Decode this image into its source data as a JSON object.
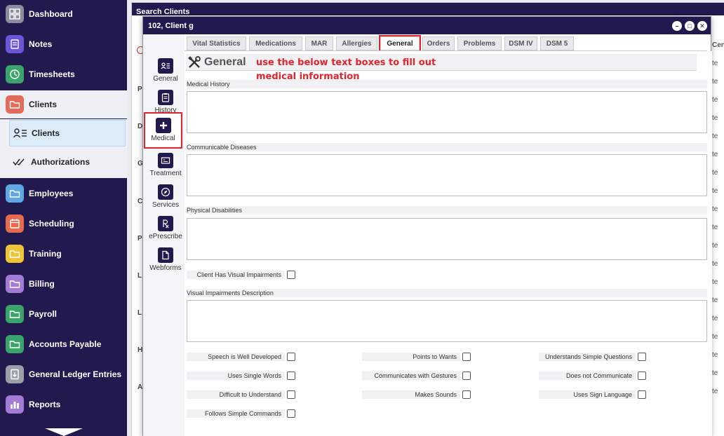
{
  "nav": {
    "items": [
      {
        "label": "Dashboard",
        "color": "#8a8d9c"
      },
      {
        "label": "Notes",
        "color": "#6b56d8"
      },
      {
        "label": "Timesheets",
        "color": "#3aa46a"
      },
      {
        "label": "Clients",
        "color": "#e26b5a"
      },
      {
        "label": "Employees",
        "color": "#5ea8e6"
      },
      {
        "label": "Scheduling",
        "color": "#e56a4f"
      },
      {
        "label": "Training",
        "color": "#f0c437"
      },
      {
        "label": "Billing",
        "color": "#a27bd6"
      },
      {
        "label": "Payroll",
        "color": "#3aa46a"
      },
      {
        "label": "Accounts Payable",
        "color": "#3aa46a"
      },
      {
        "label": "General Ledger Entries",
        "color": "#9aa0aa"
      },
      {
        "label": "Reports",
        "color": "#a27bd6"
      }
    ],
    "sub": {
      "clients": "Clients",
      "authorizations": "Authorizations"
    }
  },
  "search_window": {
    "title": "Search Clients",
    "letters": [
      "P",
      "D",
      "G",
      "C",
      "P",
      "L",
      "L",
      "H",
      "A"
    ],
    "right_header": "Cent",
    "row_text": "te"
  },
  "modal": {
    "title": "102, Client g",
    "controls": {
      "minimize": "–",
      "maximize": "□",
      "close": "✕"
    },
    "side_tabs": [
      {
        "label": "General",
        "icon": "id-card-icon"
      },
      {
        "label": "History",
        "icon": "clipboard-icon"
      },
      {
        "label": "Medical",
        "icon": "plus-icon"
      },
      {
        "label": "Treatment",
        "icon": "chart-icon"
      },
      {
        "label": "Services",
        "icon": "compass-icon"
      },
      {
        "label": "ePrescribe",
        "icon": "rx-icon"
      },
      {
        "label": "Webforms",
        "icon": "document-icon"
      }
    ],
    "top_tabs": [
      "Vital Statistics",
      "Medications",
      "MAR",
      "Allergies",
      "General",
      "Orders",
      "Problems",
      "DSM IV",
      "DSM 5"
    ],
    "active_tab": "General",
    "section_title": "General",
    "annotation_line1": "use the below text boxes to fill out",
    "annotation_line2": "medical information",
    "fields": {
      "medical_history": "Medical History",
      "communicable_diseases": "Communicable Diseases",
      "physical_disabilities": "Physical Disabilities",
      "visual_impairment_check": "Client Has Visual Impairments",
      "visual_impairments_desc": "Visual Impairments Description"
    },
    "checkboxes": {
      "col1": [
        "Speech is Well Developed",
        "Uses Single Words",
        "Difficult to Understand",
        "Follows Simple Commands"
      ],
      "col2": [
        "Points to Wants",
        "Communicates with Gestures",
        "Makes Sounds"
      ],
      "col3": [
        "Understands Simple Questions",
        "Does not Communicate",
        "Uses Sign Language"
      ]
    }
  }
}
